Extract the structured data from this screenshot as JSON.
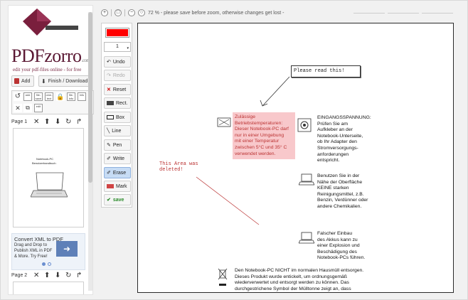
{
  "logo": {
    "brand": "PDFzorro",
    "brand_suffix": ".com",
    "tagline": "edit your pdf-files online - for free"
  },
  "left_buttons": {
    "add": "Add",
    "finish": "Finish / Download"
  },
  "tool_grid": {
    "items": [
      "file-\nsave",
      "ome-\ntext",
      "file-\ninfo",
      "edit"
    ]
  },
  "pages": {
    "page1_label": "Page 1",
    "page2_label": "Page 2"
  },
  "thumb": {
    "title": "Notebook-PC",
    "subtitle": "Benutzerhandbuch"
  },
  "ad": {
    "line1": "Convert XML to PDF",
    "line2": "Drag and Drop to",
    "line3": "Publish XML in PDF",
    "line4": "& More. Try Free!"
  },
  "topbar": {
    "zoom_text": "72 % - please",
    "save_word": "save",
    "zoom_text2": "before zoom, otherwise changes get lost -"
  },
  "toolbar": {
    "color": "#ff0000",
    "line_width": "1",
    "undo": "Undo",
    "redo": "Redo",
    "reset": "Reset",
    "rect": "Rect.",
    "box": "Box",
    "line": "Line",
    "pen": "Pen",
    "write": "Write",
    "erase": "Erase",
    "mark": "Mark",
    "save": "save"
  },
  "canvas": {
    "note": "Please read this!",
    "deleted_line1": "This Area was",
    "deleted_line2": "deleted!",
    "warning": [
      "Zulässige",
      "Betriebstemperaturen:",
      "Dieser Notebook-PC darf",
      "nur in einer Umgebung",
      "mit einer Temperatur",
      "zwischen 5°C und 35° C",
      "verwendet werden."
    ],
    "eingang": [
      "EINGANGSSPANNUNG:",
      "Prüfen Sie am",
      "Aufkleber an der",
      "Notebook-Unterseite,",
      "ob Ihr Adapter den",
      "Stromversorgungs-",
      "anforderungen",
      "entspricht."
    ],
    "chemie": [
      "Benutzen Sie in der",
      "Nähe der Oberfläche",
      "KEINE starken",
      "Reinigungsmittel, z.B.",
      "Benzin, Verdünner oder",
      "andere Chemikalien."
    ],
    "akku": [
      "Falscher Einbau",
      "des Akkus kann zu",
      "einer Explosion und",
      "Beschädigung des",
      "Notebook-PCs führen."
    ],
    "muell": [
      "Den Notebook-PC NICHT im normalen Hausmüll entsorgen.",
      "Dieses Produkt wurde entickelt, um ordnungsgemäß",
      "wiederverwertet und entsorgt werden zu können. Das",
      "durchgestrichene Symbol der Mülltonne zeigt an, dass"
    ]
  },
  "colors": {
    "accent": "#5a1833",
    "warning_bg": "#f8c8cb",
    "erase_active": "#c7dcf5"
  }
}
